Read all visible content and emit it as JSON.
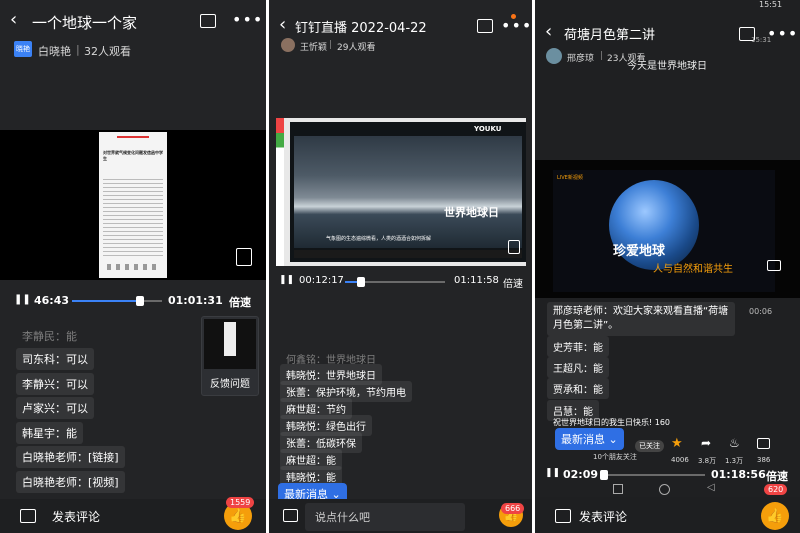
{
  "colors": {
    "accent": "#2f6fe4",
    "panel_bg": "#232426",
    "like_orange": "#f59e0b",
    "badge_red": "#ef4444"
  },
  "panel1": {
    "title": "一个地球一个家",
    "host": "白晓艳",
    "avatar_text": "晓艳",
    "viewers": "32人观看",
    "video_doc_heading": "对世界就气候变化问题发信函中学生",
    "time_current": "46:43",
    "time_total": "01:01:31",
    "progress": 0.76,
    "speed": "倍速",
    "chat": [
      {
        "text": "李静民：能",
        "dim": true
      },
      {
        "text": "司东科：可以",
        "dim": false
      },
      {
        "text": "李静兴：可以",
        "dim": false
      },
      {
        "text": "卢家兴：可以",
        "dim": false
      },
      {
        "text": "韩星宇：能",
        "dim": false
      },
      {
        "text": "白晓艳老师：[链接]",
        "dim": false
      },
      {
        "text": "白晓艳老师：[视频]",
        "dim": false
      }
    ],
    "feedback_label": "反馈问题",
    "comment_label": "发表评论",
    "like_count": "1559"
  },
  "panel2": {
    "title": "钉钉直播 2022-04-22",
    "host": "王忻颖",
    "viewers": "29人观看",
    "video_logo": "YOUKU",
    "video_caption": "气象图的生态遍综微看，人类的酒酒合如何拆解",
    "video_art": "世界地球日",
    "time_current": "00:12:17",
    "time_total": "01:11:58",
    "progress": 0.16,
    "speed": "倍速",
    "chat": [
      {
        "text": "何鑫铭：世界地球日",
        "dim": true
      },
      {
        "text": "韩晓悦：世界地球日",
        "dim": false
      },
      {
        "text": "张蕾：保护环境，节约用电",
        "dim": false
      },
      {
        "text": "麻世超：节约",
        "dim": false
      },
      {
        "text": "韩晓悦：绿色出行",
        "dim": false
      },
      {
        "text": "张蕾：低碳环保",
        "dim": false
      },
      {
        "text": "麻世超：能",
        "dim": false
      },
      {
        "text": "韩晓悦：能",
        "dim": false
      }
    ],
    "new_msg_label": "最新消息",
    "input_placeholder": "说点什么吧",
    "like_count": "666"
  },
  "panel3": {
    "title": "荷塘月色第二讲",
    "host": "邢彦琼",
    "viewers": "23人观看",
    "status_time": "15:31",
    "status_time2": "15:51",
    "banner_text": "今天是世界地球日",
    "video_tag": "LIVE新视频",
    "video_art_main": "珍爱地球",
    "video_art_sub": "人与自然和谐共生",
    "chat": [
      {
        "text": "邢彦琼老师：欢迎大家来观看直播“荷塘月色第二讲”。",
        "dim": false,
        "time": "00:06"
      },
      {
        "text": "史芳菲：能",
        "dim": false
      },
      {
        "text": "王超凡：能",
        "dim": false
      },
      {
        "text": "贾承和：能",
        "dim": false
      },
      {
        "text": "吕慧：能",
        "dim": false
      },
      {
        "text": "祝世界地球日的我生日快乐! 160",
        "dim": false
      }
    ],
    "new_msg_label": "最新消息",
    "follow_sub": "10个朋友关注",
    "follow_badge": "已关注",
    "stats": {
      "star": "4006",
      "share": "3.8万",
      "flame": "1.3万",
      "comment": "386"
    },
    "time_current": "02:09",
    "time_total": "01:18:56",
    "progress": 0.03,
    "speed": "倍速",
    "comment_label": "发表评论",
    "like_count": "620"
  }
}
